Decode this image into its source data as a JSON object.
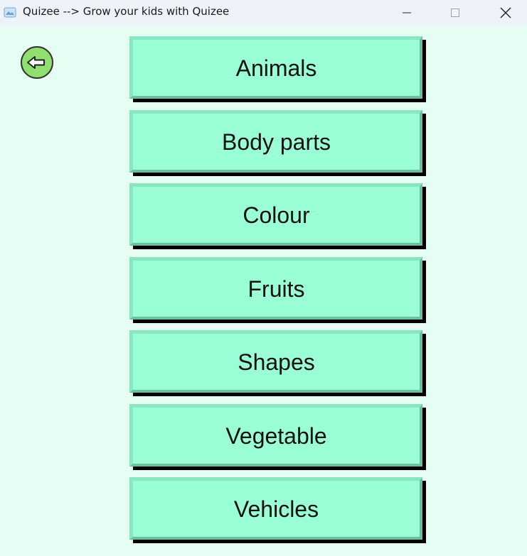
{
  "window": {
    "title": "Quizee --> Grow your kids with Quizee",
    "controls": [
      "minimize-icon",
      "maximize-icon",
      "close-icon"
    ]
  },
  "back": {
    "icon": "arrow-left-circle-icon",
    "color": "#8fe070"
  },
  "categories": [
    {
      "label": "Animals"
    },
    {
      "label": "Body parts"
    },
    {
      "label": "Colour"
    },
    {
      "label": "Fruits"
    },
    {
      "label": "Shapes"
    },
    {
      "label": "Vegetable"
    },
    {
      "label": "Vehicles"
    }
  ],
  "colors": {
    "background": "#e6fdf3",
    "button_face": "#9bffd6",
    "titlebar": "#eef3fa"
  }
}
